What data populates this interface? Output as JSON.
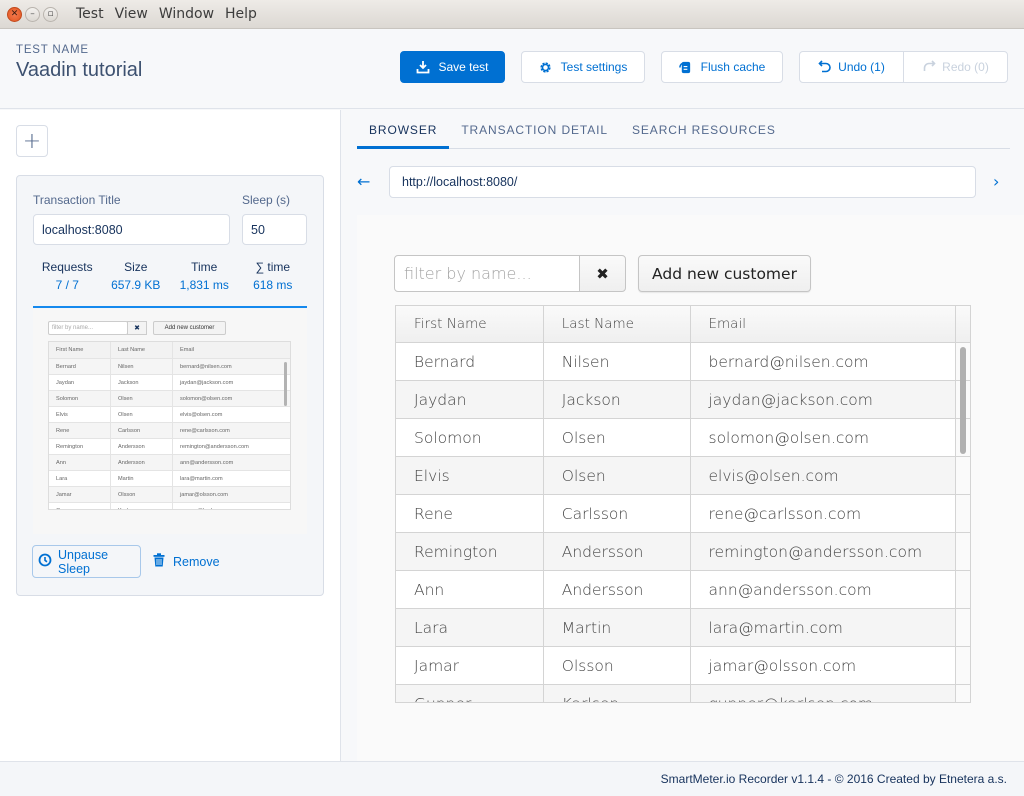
{
  "window": {
    "menu": [
      "Test",
      "View",
      "Window",
      "Help"
    ]
  },
  "header": {
    "label": "TEST NAME",
    "test_name": "Vaadin tutorial",
    "buttons": {
      "save": "Save test",
      "settings": "Test settings",
      "flush": "Flush cache",
      "undo": "Undo (1)",
      "redo": "Redo (0)"
    },
    "colors": {
      "primary": "#0070d2",
      "disabled": "#c9d2de"
    }
  },
  "transaction": {
    "title_label": "Transaction Title",
    "title_value": "localhost:8080",
    "sleep_label": "Sleep (s)",
    "sleep_value": "50",
    "stats": [
      {
        "label": "Requests",
        "value": "7 / 7"
      },
      {
        "label": "Size",
        "value": "657.9 KB"
      },
      {
        "label": "Time",
        "value": "1,831 ms"
      },
      {
        "label": "∑ time",
        "value": "618 ms"
      }
    ],
    "unpause_label": "Unpause Sleep",
    "remove_label": "Remove"
  },
  "tabs": [
    {
      "label": "BROWSER",
      "active": true
    },
    {
      "label": "TRANSACTION DETAIL",
      "active": false
    },
    {
      "label": "SEARCH RESOURCES",
      "active": false
    }
  ],
  "browser": {
    "url": "http://localhost:8080/"
  },
  "app": {
    "filter_placeholder": "filter by name...",
    "clear_icon": "✖",
    "add_label": "Add new customer",
    "columns": [
      "First Name",
      "Last Name",
      "Email"
    ],
    "rows": [
      [
        "Bernard",
        "Nilsen",
        "bernard@nilsen.com"
      ],
      [
        "Jaydan",
        "Jackson",
        "jaydan@jackson.com"
      ],
      [
        "Solomon",
        "Olsen",
        "solomon@olsen.com"
      ],
      [
        "Elvis",
        "Olsen",
        "elvis@olsen.com"
      ],
      [
        "Rene",
        "Carlsson",
        "rene@carlsson.com"
      ],
      [
        "Remington",
        "Andersson",
        "remington@andersson.com"
      ],
      [
        "Ann",
        "Andersson",
        "ann@andersson.com"
      ],
      [
        "Lara",
        "Martin",
        "lara@martin.com"
      ],
      [
        "Jamar",
        "Olsson",
        "jamar@olsson.com"
      ],
      [
        "Gunner",
        "Karlsen",
        "gunner@karlsen.com"
      ]
    ]
  },
  "footer": {
    "text": "SmartMeter.io Recorder v1.1.4 - © 2016 Created by Etnetera a.s."
  }
}
